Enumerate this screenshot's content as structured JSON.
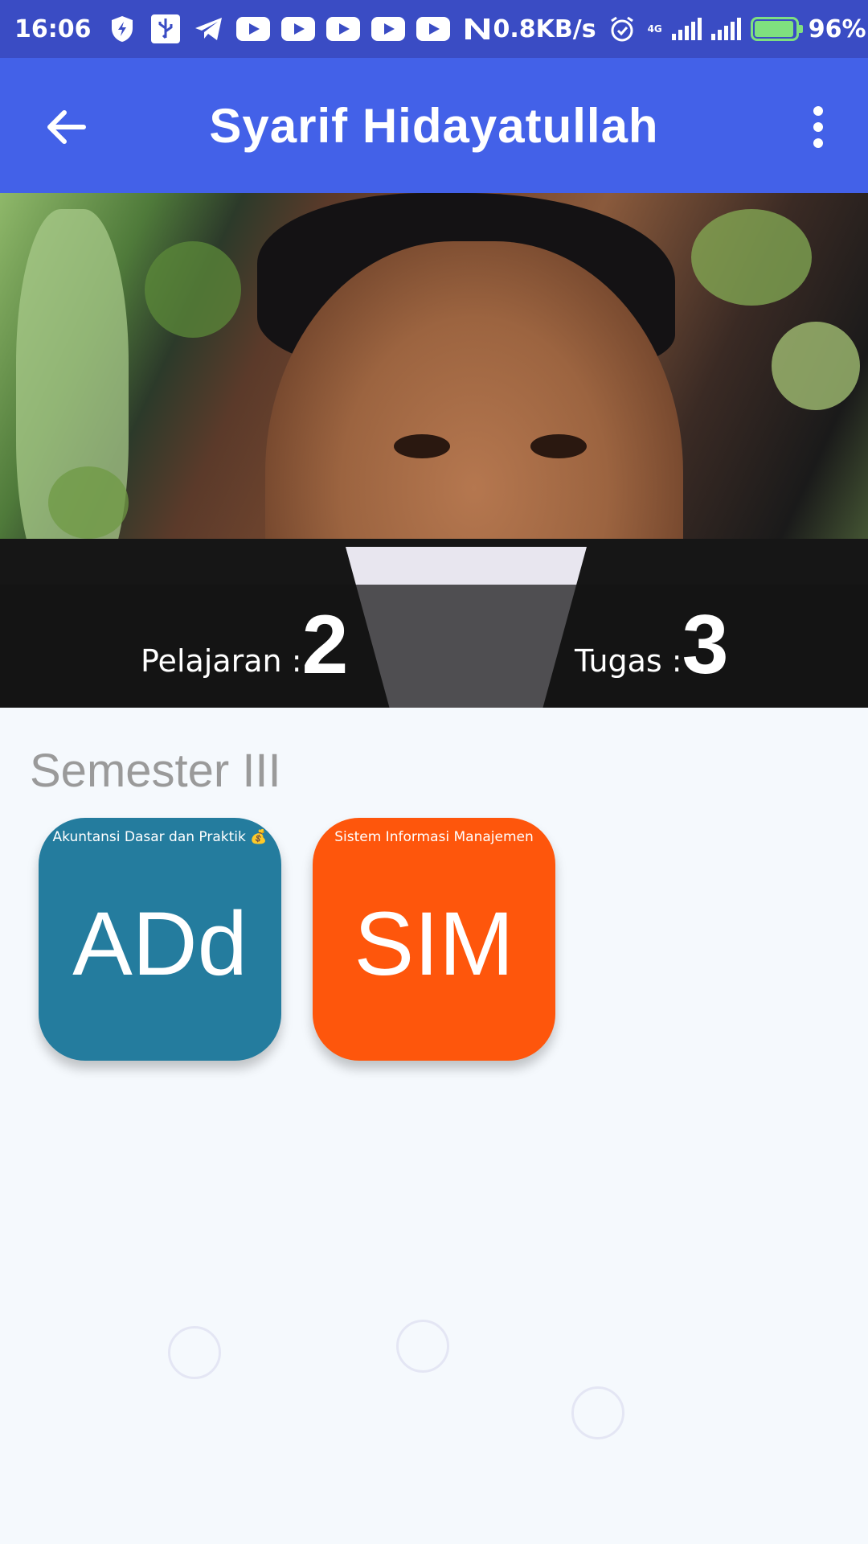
{
  "status_bar": {
    "time": "16:06",
    "net_speed": "0.8KB/s",
    "network_label": "4G",
    "battery": "96%",
    "battery_level": 0.96,
    "icons": [
      "shield-icon",
      "usb-icon",
      "telegram-icon",
      "youtube-icon",
      "youtube-icon",
      "youtube-icon",
      "youtube-icon",
      "youtube-icon",
      "n-icon",
      "alarm-icon",
      "signal-icon",
      "signal-icon",
      "battery-icon"
    ]
  },
  "app_bar": {
    "title": "Syarif Hidayatullah",
    "back_icon": "arrow-back-icon",
    "menu_icon": "more-vert-icon",
    "color": "#4361e8"
  },
  "profile": {
    "stats": [
      {
        "label": "Pelajaran :",
        "value": "2"
      },
      {
        "label": "Tugas :",
        "value": "3"
      }
    ]
  },
  "semester": {
    "title": "Semester III",
    "courses": [
      {
        "name": "Akuntansi Dasar dan Praktik 💰",
        "abbr": "ADd",
        "color": "#247c9e"
      },
      {
        "name": "Sistem Informasi Manajemen",
        "abbr": "SIM",
        "color": "#fe560c"
      }
    ]
  }
}
